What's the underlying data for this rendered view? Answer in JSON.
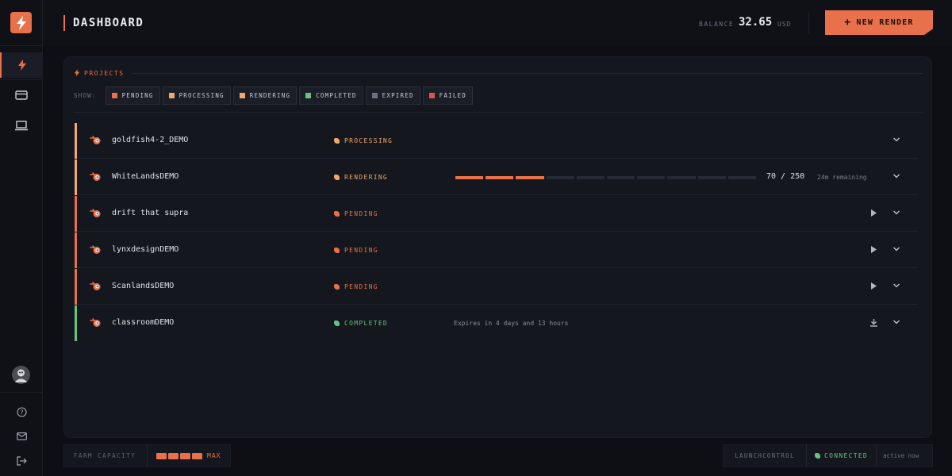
{
  "header": {
    "title": "DASHBOARD",
    "balance_label": "BALANCE",
    "balance_value": "32.65",
    "balance_unit": "USD",
    "new_render_label": "NEW RENDER"
  },
  "sidebar": {
    "items": [
      {
        "icon": "bolt-icon",
        "active": true
      },
      {
        "icon": "credit-card-icon",
        "active": false
      },
      {
        "icon": "laptop-icon",
        "active": false
      }
    ],
    "bottom": [
      {
        "icon": "help-icon"
      },
      {
        "icon": "mail-icon"
      },
      {
        "icon": "logout-icon"
      }
    ]
  },
  "projects": {
    "section_label": "PROJECTS",
    "show_label": "SHOW:",
    "filters": [
      {
        "label": "PENDING",
        "color": "#e8704a"
      },
      {
        "label": "PROCESSING",
        "color": "#f2a76b"
      },
      {
        "label": "RENDERING",
        "color": "#f2a76b"
      },
      {
        "label": "COMPLETED",
        "color": "#63c57f"
      },
      {
        "label": "EXPIRED",
        "color": "#6c7080"
      },
      {
        "label": "FAILED",
        "color": "#e0524a"
      }
    ],
    "rows": [
      {
        "name": "goldfish4-2_DEMO",
        "status": "PROCESSING",
        "color": "#f2a76b",
        "action": "none"
      },
      {
        "name": "WhiteLandsDEMO",
        "status": "RENDERING",
        "color": "#f2a76b",
        "action": "none",
        "progress": {
          "done": 70,
          "total": 250,
          "text": "70 / 250",
          "remaining": "24m remaining"
        }
      },
      {
        "name": "drift that supra",
        "status": "PENDING",
        "color": "#e8704a",
        "action": "play"
      },
      {
        "name": "lynxdesignDEMO",
        "status": "PENDING",
        "color": "#e8704a",
        "action": "play"
      },
      {
        "name": "ScanlandsDEMO",
        "status": "PENDING",
        "color": "#e8704a",
        "action": "play"
      },
      {
        "name": "classroomDEMO",
        "status": "COMPLETED",
        "color": "#63c57f",
        "action": "download",
        "expires": "Expires in 4 days and 13 hours"
      }
    ]
  },
  "footer": {
    "farm_capacity_label": "FARM CAPACITY",
    "capacity_value": "MAX",
    "launchcontrol_label": "LAUNCHCONTROL",
    "connection_status": "CONNECTED",
    "active_text": "active now"
  }
}
